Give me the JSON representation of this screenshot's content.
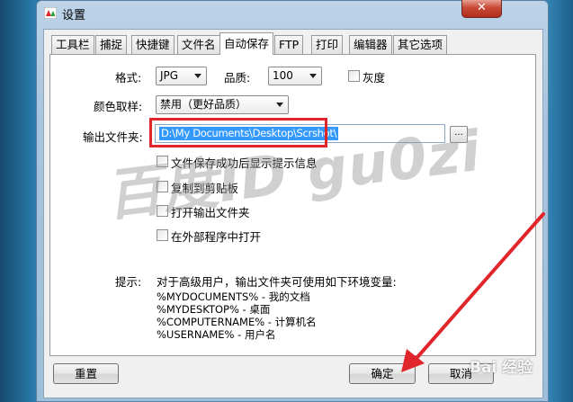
{
  "window": {
    "title": "设置",
    "close_label": "✕"
  },
  "tabs": [
    {
      "label": "工具栏",
      "active": false
    },
    {
      "label": "捕捉",
      "active": false
    },
    {
      "label": "快捷键",
      "active": false
    },
    {
      "label": "文件名",
      "active": false
    },
    {
      "label": "自动保存",
      "active": true
    },
    {
      "label": "FTP",
      "active": false
    },
    {
      "label": "打印",
      "active": false
    },
    {
      "label": "编辑器",
      "active": false
    },
    {
      "label": "其它选项",
      "active": false
    }
  ],
  "form": {
    "format_label": "格式:",
    "format_value": "JPG",
    "quality_label": "品质:",
    "quality_value": "100",
    "grayscale_label": "灰度",
    "color_label": "颜色取样:",
    "color_value": "禁用（更好品质）",
    "output_label": "输出文件夹:",
    "output_value": "D:\\My Documents\\Desktop\\Scrshot\\",
    "browse_label": "...",
    "options": [
      {
        "label": "文件保存成功后显示提示信息",
        "checked": false
      },
      {
        "label": "复制到剪贴板",
        "checked": false
      },
      {
        "label": "打开输出文件夹",
        "checked": false
      },
      {
        "label": "在外部程序中打开",
        "checked": false
      }
    ]
  },
  "hint": {
    "label": "提示:",
    "intro": "对于高级用户，输出文件夹可使用如下环境变量:",
    "vars": [
      "%MYDOCUMENTS% - 我的文档",
      "%MYDESKTOP% - 桌面",
      "%COMPUTERNAME% - 计算机名",
      "%USERNAME% - 用户名"
    ]
  },
  "buttons": {
    "reset": "重置",
    "ok": "确定",
    "cancel": "取消"
  },
  "watermark": "百度ID gu0zi",
  "site_mark": "Bai 经验",
  "colors": {
    "highlight": "#e0262b",
    "selection": "#3399ff"
  },
  "icons": {
    "app": "app-logo-icon",
    "close": "close-icon",
    "dropdown": "chevron-down-icon"
  }
}
